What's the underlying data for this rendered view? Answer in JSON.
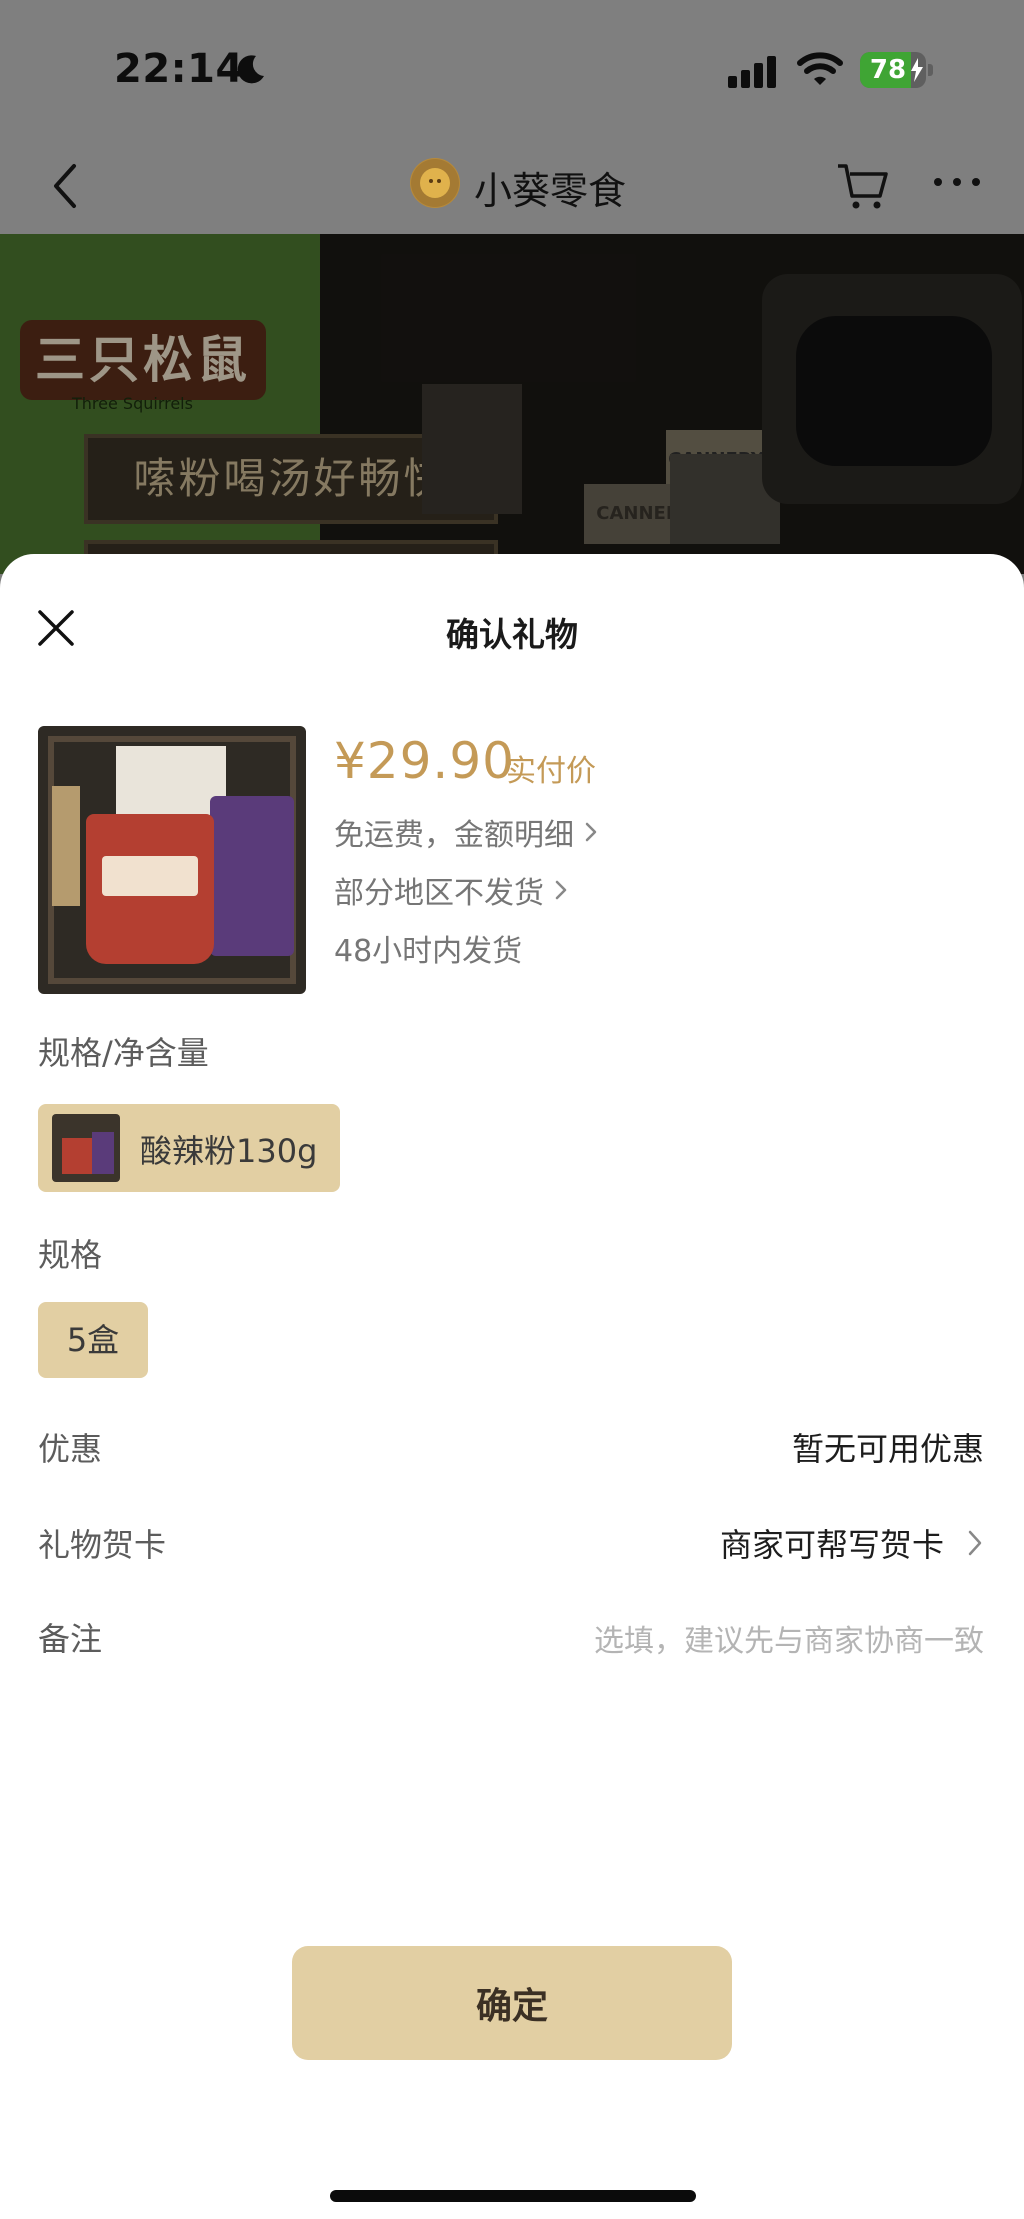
{
  "status_bar": {
    "time": "22:14",
    "battery_percent": "78",
    "battery_level": 0.78,
    "icons": [
      "moon-icon",
      "signal-icon",
      "wifi-icon",
      "battery-charging-icon"
    ]
  },
  "nav": {
    "shop_name": "小葵零食",
    "icons": [
      "back-icon",
      "shop-logo",
      "cart-icon",
      "more-icon"
    ]
  },
  "banner": {
    "brand": "三只松鼠",
    "brand_en": "Three Squirrels",
    "slogan": "嗦粉喝汤好畅快",
    "can_text": "CANNERY",
    "can_text_2": "CANNERY"
  },
  "sheet": {
    "title": "确认礼物",
    "product": {
      "price": "¥29.90",
      "price_tag": "实付价",
      "shipping": "免运费，金额明细",
      "region": "部分地区不发货",
      "dispatch": "48小时内发货"
    },
    "spec_label": "规格/净含量",
    "spec_option": "酸辣粉130g",
    "size_label": "规格",
    "size_option": "5盒",
    "discount_label": "优惠",
    "discount_value": "暂无可用优惠",
    "card_label": "礼物贺卡",
    "card_value": "商家可帮写贺卡",
    "note_label": "备注",
    "note_placeholder": "选填，建议先与商家协商一致",
    "confirm_label": "确定"
  },
  "colors": {
    "accent": "#c49a57",
    "chip": "#e2cfa3",
    "overlay": "#7f7f7f"
  }
}
